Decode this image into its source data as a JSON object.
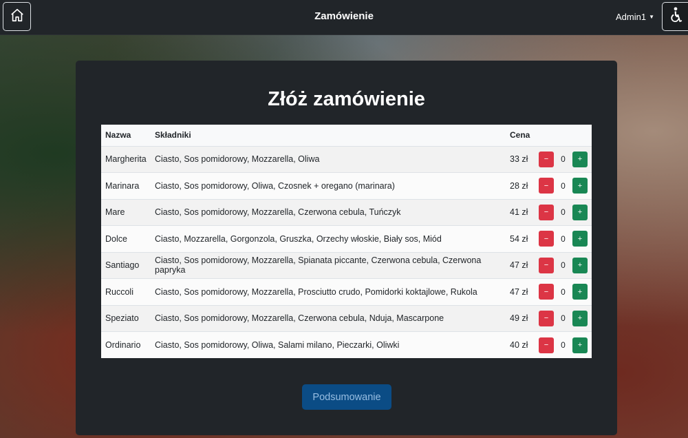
{
  "navbar": {
    "title": "Zamówienie",
    "user": "Admin1",
    "home_icon": "home-icon",
    "accessibility_icon": "wheelchair-icon"
  },
  "card": {
    "title": "Złóż zamówienie",
    "summary_button": "Podsumowanie"
  },
  "table": {
    "headers": {
      "name": "Nazwa",
      "ingredients": "Składniki",
      "price": "Cena"
    },
    "rows": [
      {
        "name": "Margherita",
        "ingredients": "Ciasto, Sos pomidorowy, Mozzarella, Oliwa",
        "price": "33 zł",
        "qty": "0"
      },
      {
        "name": "Marinara",
        "ingredients": "Ciasto, Sos pomidorowy, Oliwa, Czosnek + oregano (marinara)",
        "price": "28 zł",
        "qty": "0"
      },
      {
        "name": "Mare",
        "ingredients": "Ciasto, Sos pomidorowy, Mozzarella, Czerwona cebula, Tuńczyk",
        "price": "41 zł",
        "qty": "0"
      },
      {
        "name": "Dolce",
        "ingredients": "Ciasto, Mozzarella, Gorgonzola, Gruszka, Orzechy włoskie, Biały sos, Miód",
        "price": "54 zł",
        "qty": "0"
      },
      {
        "name": "Santiago",
        "ingredients": "Ciasto, Sos pomidorowy, Mozzarella, Spianata piccante, Czerwona cebula, Czerwona papryka",
        "price": "47 zł",
        "qty": "0"
      },
      {
        "name": "Ruccoli",
        "ingredients": "Ciasto, Sos pomidorowy, Mozzarella, Prosciutto crudo, Pomidorki koktajlowe, Rukola",
        "price": "47 zł",
        "qty": "0"
      },
      {
        "name": "Speziato",
        "ingredients": "Ciasto, Sos pomidorowy, Mozzarella, Czerwona cebula, Nduja, Mascarpone",
        "price": "49 zł",
        "qty": "0"
      },
      {
        "name": "Ordinario",
        "ingredients": "Ciasto, Sos pomidorowy, Oliwa, Salami milano, Pieczarki, Oliwki",
        "price": "40 zł",
        "qty": "0"
      }
    ],
    "minus_label": "−",
    "plus_label": "+"
  },
  "colors": {
    "navbar_bg": "#212529",
    "card_bg": "#212529",
    "minus_btn": "#dc3545",
    "plus_btn": "#198754",
    "summary_btn": "#0a4f8a"
  }
}
